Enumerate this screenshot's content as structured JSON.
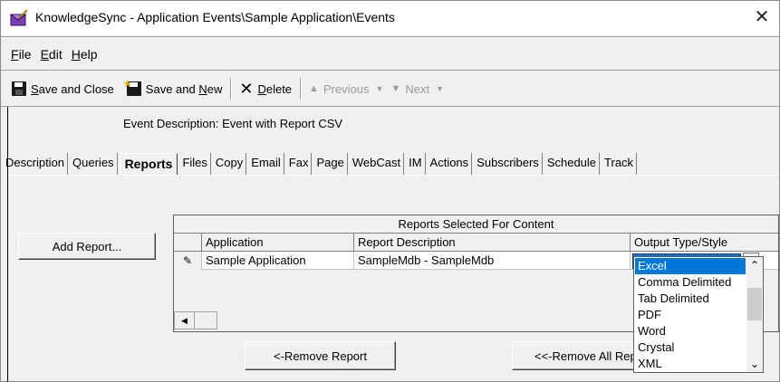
{
  "window": {
    "title": "KnowledgeSync - Application Events\\Sample Application\\Events",
    "close_glyph": "✕"
  },
  "menu": {
    "file": {
      "u": "F",
      "rest": "ile"
    },
    "edit": {
      "u": "E",
      "rest": "dit"
    },
    "help": {
      "u": "H",
      "rest": "elp"
    }
  },
  "toolbar": {
    "save_close_u": "S",
    "save_close_rest": "ave and Close",
    "save_new_pre": "Save and ",
    "save_new_u": "N",
    "save_new_rest": "ew",
    "delete_u": "D",
    "delete_rest": "elete",
    "previous": "Previous",
    "next": "Next"
  },
  "event": {
    "label": "Event Description:",
    "value": "Event with Report CSV"
  },
  "tabs": [
    "Description",
    "Queries",
    "Reports",
    "Files",
    "Copy",
    "Email",
    "Fax",
    "Page",
    "WebCast",
    "IM",
    "Actions",
    "Subscribers",
    "Schedule",
    "Track"
  ],
  "active_tab": "Reports",
  "buttons": {
    "add_report": "Add Report...",
    "remove_report": "<-Remove Report",
    "remove_all": "<<-Remove All Reports"
  },
  "grid": {
    "caption": "Reports Selected For Content",
    "columns": [
      "Application",
      "Report Description",
      "Output Type/Style"
    ],
    "row": {
      "edit_glyph": "✎",
      "application": "Sample Application",
      "report_description": "SampleMdb - SampleMdb",
      "output_type": "Comma Delimited"
    }
  },
  "output_options": [
    "Excel",
    "Comma Delimited",
    "Tab Delimited",
    "PDF",
    "Word",
    "Crystal",
    "XML"
  ],
  "highlighted_option": "Excel",
  "colors": {
    "selection": "#0078d7",
    "window_bg": "#f0f0f0"
  }
}
